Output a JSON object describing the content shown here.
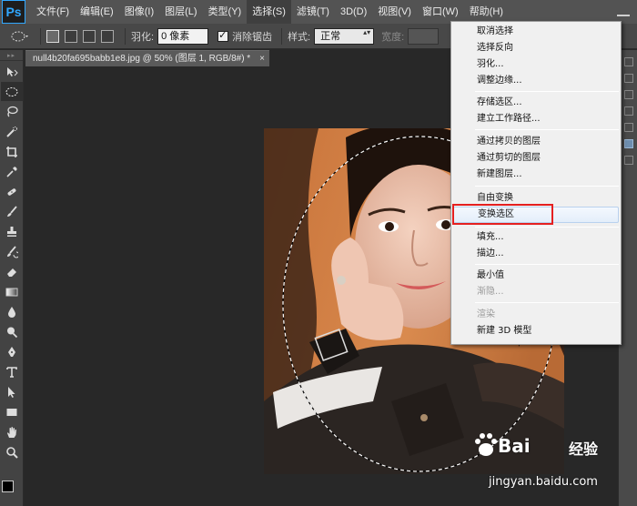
{
  "app": {
    "logo_text": "Ps",
    "accent_color": "#31a8ff"
  },
  "menubar": {
    "items": [
      {
        "label": "文件(F)"
      },
      {
        "label": "编辑(E)"
      },
      {
        "label": "图像(I)"
      },
      {
        "label": "图层(L)"
      },
      {
        "label": "类型(Y)"
      },
      {
        "label": "选择(S)"
      },
      {
        "label": "滤镜(T)"
      },
      {
        "label": "3D(D)"
      },
      {
        "label": "视图(V)"
      },
      {
        "label": "窗口(W)"
      },
      {
        "label": "帮助(H)"
      }
    ],
    "open_menu": "选择(S)"
  },
  "options": {
    "feather_label": "羽化:",
    "feather_value": "0 像素",
    "antialias_label": "消除锯齿",
    "antialias_checked": true,
    "style_label": "样式:",
    "style_value": "正常",
    "width_label": "宽度:"
  },
  "document": {
    "tab_title": "null4b20fa695babb1e8.jpg @ 50% (图层 1, RGB/8#) *",
    "close_glyph": "×"
  },
  "tools": [
    {
      "icon": "move-icon"
    },
    {
      "icon": "elliptical-marquee-icon",
      "active": true
    },
    {
      "icon": "lasso-icon"
    },
    {
      "icon": "quick-selection-icon"
    },
    {
      "icon": "crop-icon"
    },
    {
      "icon": "eyedropper-icon"
    },
    {
      "icon": "healing-brush-icon"
    },
    {
      "icon": "brush-icon"
    },
    {
      "icon": "clone-stamp-icon"
    },
    {
      "icon": "history-brush-icon"
    },
    {
      "icon": "eraser-icon"
    },
    {
      "icon": "gradient-icon"
    },
    {
      "icon": "blur-icon"
    },
    {
      "icon": "dodge-icon"
    },
    {
      "icon": "pen-icon"
    },
    {
      "icon": "type-icon"
    },
    {
      "icon": "path-selection-icon"
    },
    {
      "icon": "rectangle-icon"
    },
    {
      "icon": "hand-icon"
    },
    {
      "icon": "zoom-icon"
    }
  ],
  "colors": {
    "foreground": "#000000",
    "background": "#ffffff"
  },
  "select_menu": {
    "items": [
      {
        "label": "取消选择"
      },
      {
        "label": "选择反向"
      },
      {
        "label": "羽化..."
      },
      {
        "label": "调整边缘..."
      },
      {
        "label": "存储选区..."
      },
      {
        "label": "建立工作路径..."
      },
      {
        "label": "通过拷贝的图层"
      },
      {
        "label": "通过剪切的图层"
      },
      {
        "label": "新建图层..."
      },
      {
        "label": "自由变换"
      },
      {
        "label": "变换选区",
        "highlighted": true
      },
      {
        "label": "填充..."
      },
      {
        "label": "描边..."
      },
      {
        "label": "最小值"
      },
      {
        "label": "渐隐...",
        "disabled": true
      },
      {
        "label": "渲染",
        "disabled": true
      },
      {
        "label": "新建 3D 模型"
      }
    ],
    "highlight_color": "#e52020"
  },
  "watermark": {
    "logo_left": "Bai",
    "logo_right": "经验",
    "url": "jingyan.baidu.com"
  }
}
